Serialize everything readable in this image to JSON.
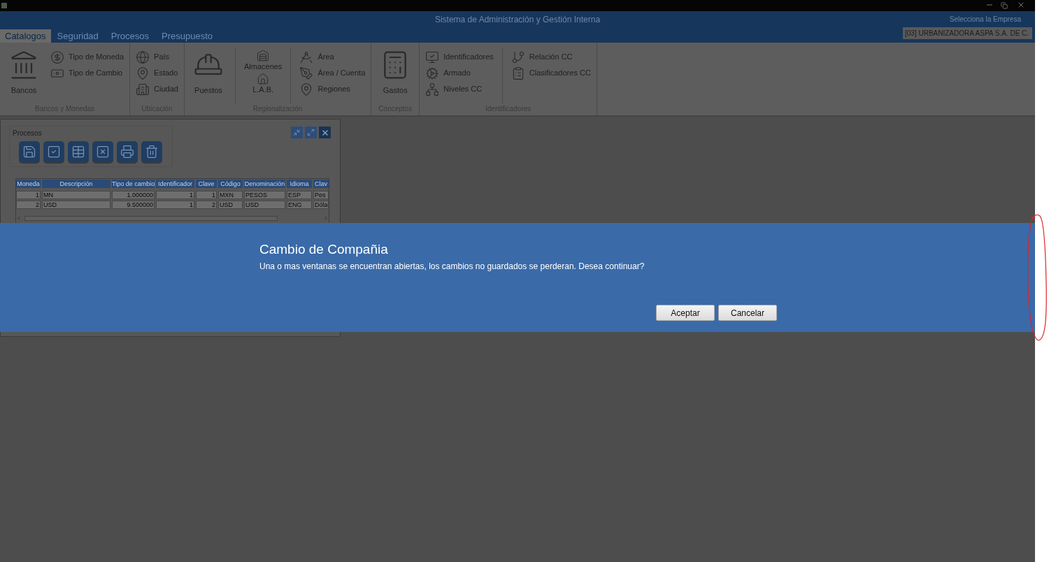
{
  "window": {
    "title": "Sistema de Administración y Gestión Interna",
    "company_label": "Selecciona la Empresa",
    "company_value": "[03] URBANIZADORA ASPA S.A. DE C."
  },
  "tabs": [
    {
      "label": "Catalogos",
      "selected": true
    },
    {
      "label": "Seguridad",
      "selected": false
    },
    {
      "label": "Procesos",
      "selected": false
    },
    {
      "label": "Presupuesto",
      "selected": false
    }
  ],
  "ribbon": {
    "groups": [
      {
        "label": "Bancos y Monedas",
        "columns": [
          [
            {
              "label": "Bancos",
              "kind": "large"
            }
          ],
          [
            {
              "label": "Tipo de Moneda",
              "kind": "small"
            },
            {
              "label": "Tipo de Cambio",
              "kind": "small"
            }
          ]
        ]
      },
      {
        "label": "Ubicación",
        "columns": [
          [
            {
              "label": "País",
              "kind": "small"
            },
            {
              "label": "Estado",
              "kind": "small"
            },
            {
              "label": "Ciudad",
              "kind": "small"
            }
          ]
        ]
      },
      {
        "label": "Regionalización",
        "columns": [
          [
            {
              "label": "Puestos",
              "kind": "large"
            }
          ],
          [
            {
              "label": "Almacenes",
              "kind": "medium"
            },
            {
              "label": "L.A.B.",
              "kind": "medium"
            }
          ],
          [
            {
              "label": "Área",
              "kind": "small"
            },
            {
              "label": "Área / Cuenta",
              "kind": "small"
            },
            {
              "label": "Regiones",
              "kind": "small"
            }
          ]
        ]
      },
      {
        "label": "Conceptos",
        "columns": [
          [
            {
              "label": "Gastos",
              "kind": "large"
            }
          ]
        ]
      },
      {
        "label": "Identificadores",
        "columns": [
          [
            {
              "label": "Identificadores",
              "kind": "small"
            },
            {
              "label": "Armado",
              "kind": "small"
            },
            {
              "label": "Niveles CC",
              "kind": "small"
            }
          ],
          [
            {
              "label": "Relación CC",
              "kind": "small"
            },
            {
              "label": "Clasificadores CC",
              "kind": "small"
            }
          ]
        ]
      }
    ]
  },
  "child_window": {
    "toolbar_label": "Procesos",
    "table": {
      "columns": [
        "Moneda",
        "Descripción",
        "Tipo de cambio",
        "Identificador",
        "Clave",
        "Código",
        "Denominación",
        "Idioma",
        "Clav"
      ],
      "rows": [
        [
          "1",
          "MN",
          "1.000000",
          "1",
          "1",
          "MXN",
          "PESOS",
          "ESP",
          "Pes"
        ],
        [
          "2",
          "USD",
          "9.500000",
          "1",
          "2",
          "USD",
          "USD",
          "ENG",
          "Dóla"
        ]
      ]
    }
  },
  "dialog": {
    "title": "Cambio de Compañia",
    "message": "Una o mas ventanas se encuentran abiertas, los cambios no guardados se perderan. Desea continuar?",
    "buttons": [
      "Aceptar",
      "Cancelar"
    ]
  }
}
